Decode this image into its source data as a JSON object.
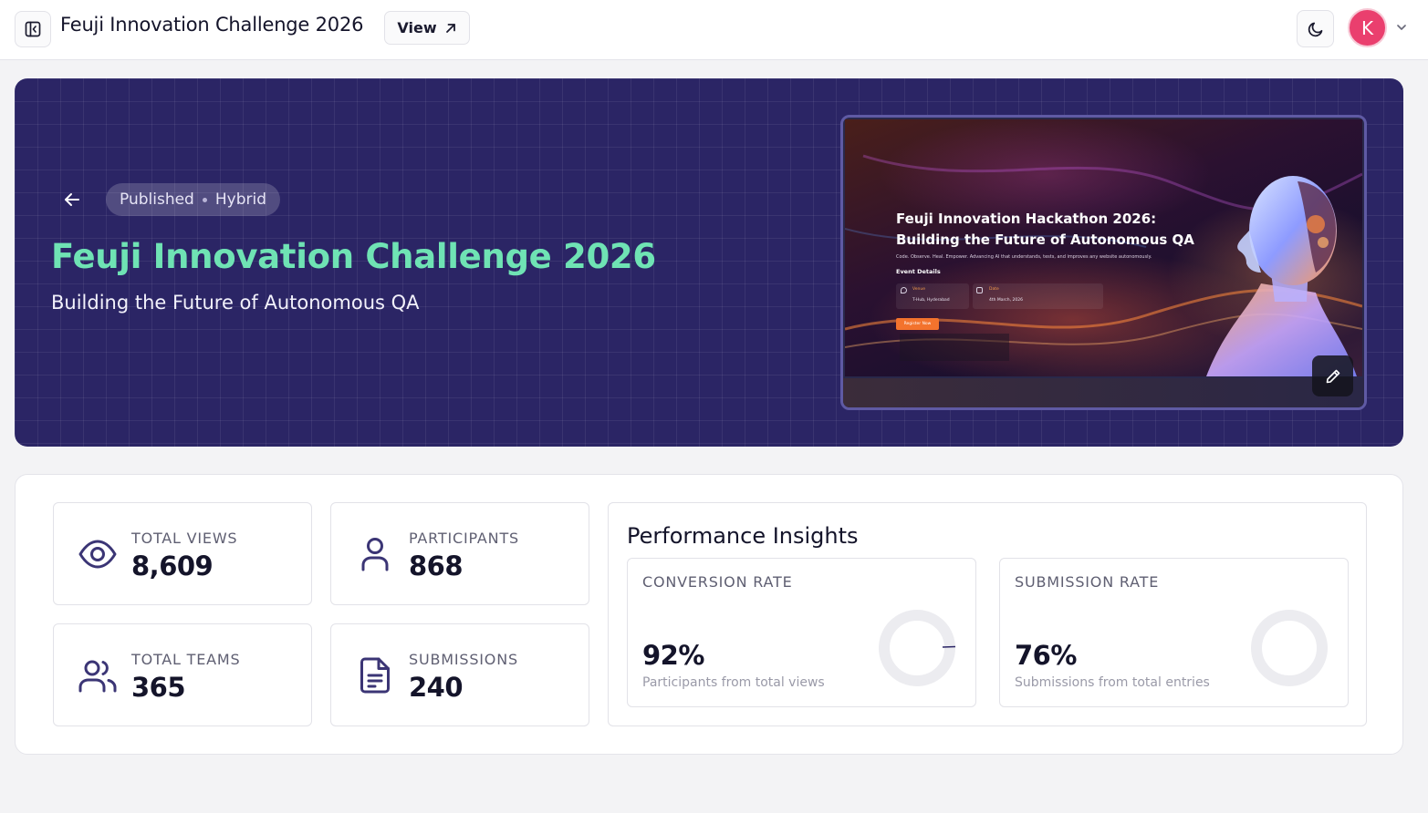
{
  "header": {
    "title": "Feuji Innovation Challenge 2026",
    "view_label": "View",
    "avatar_initial": "K"
  },
  "hero": {
    "status": "Published",
    "mode": "Hybrid",
    "title": "Feuji Innovation Challenge 2026",
    "subtitle": "Building the Future of Autonomous QA",
    "title_color": "#6fe3b4",
    "background": "#2b2565",
    "preview": {
      "heading": "Feuji Innovation Hackathon 2026: Building the Future of Autonomous QA",
      "tagline": "Code. Observe. Heal. Empower. Advancing AI that understands, tests, and improves any website autonomously.",
      "details_heading": "Event Details",
      "venue_label": "Venue",
      "venue_value": "T-Hub, Hyderabad",
      "date_label": "Date",
      "date_value": "4th March, 2026",
      "register_label": "Register Now"
    }
  },
  "stats": [
    {
      "label": "TOTAL VIEWS",
      "value": "8,609",
      "icon": "eye-icon"
    },
    {
      "label": "PARTICIPANTS",
      "value": "868",
      "icon": "user-icon"
    },
    {
      "label": "TOTAL TEAMS",
      "value": "365",
      "icon": "users-icon"
    },
    {
      "label": "SUBMISSIONS",
      "value": "240",
      "icon": "file-text-icon"
    }
  ],
  "insights": {
    "title": "Performance Insights",
    "conversion": {
      "label": "CONVERSION RATE",
      "value": "92%",
      "description": "Participants from total views"
    },
    "submission": {
      "label": "SUBMISSION RATE",
      "value": "76%",
      "description": "Submissions from total entries"
    }
  },
  "colors": {
    "accent": "#3b3575",
    "avatar": "#ea3f6e",
    "ring_track": "#ececf0"
  }
}
